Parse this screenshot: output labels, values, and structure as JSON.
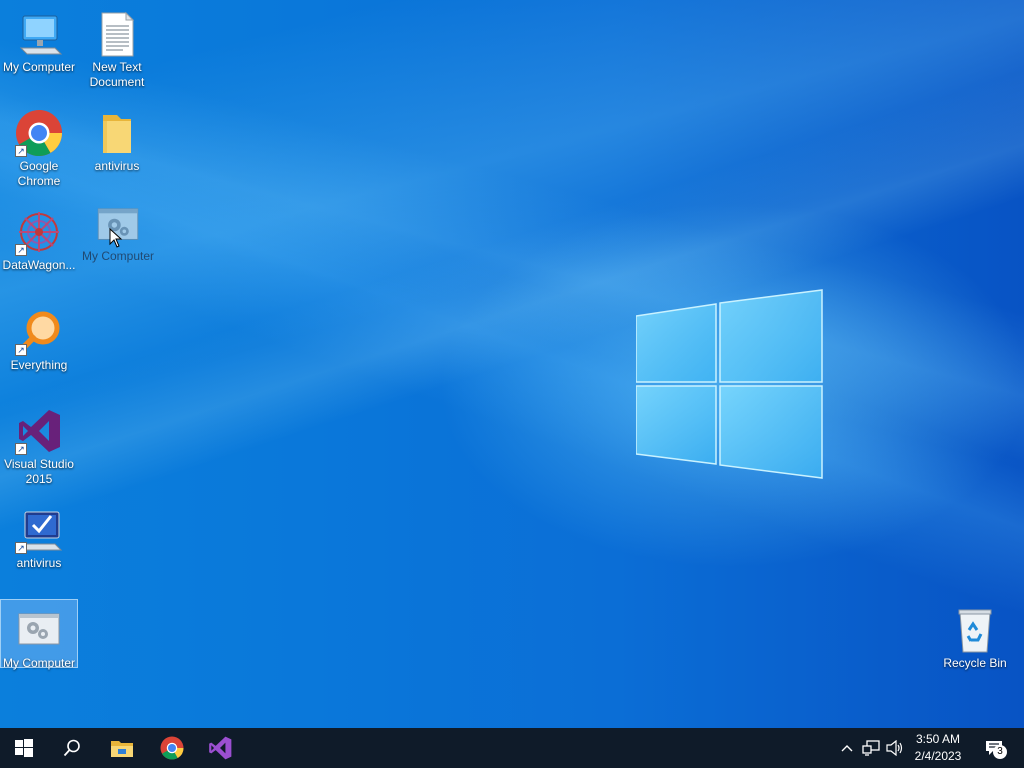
{
  "desktop": {
    "icons": [
      {
        "label": "My Computer",
        "icon": "computer-icon"
      },
      {
        "label": "New Text Document",
        "icon": "text-document-icon"
      },
      {
        "label": "Google Chrome",
        "icon": "chrome-icon"
      },
      {
        "label": "antivirus",
        "icon": "folder-icon"
      },
      {
        "label": "DataWagon...",
        "icon": "datawagon-icon"
      },
      {
        "label": "My Computer",
        "icon": "settings-window-icon"
      },
      {
        "label": "Everything",
        "icon": "everything-search-icon"
      },
      {
        "label": "Visual Studio 2015",
        "icon": "visual-studio-icon"
      },
      {
        "label": "antivirus",
        "icon": "antivirus-monitor-icon"
      },
      {
        "label": "My Computer",
        "icon": "settings-window-icon"
      },
      {
        "label": "Recycle Bin",
        "icon": "recycle-bin-icon"
      }
    ]
  },
  "taskbar": {
    "pinned": [
      "start-icon",
      "search-icon",
      "file-explorer-icon",
      "chrome-icon",
      "visual-studio-icon"
    ],
    "tray": {
      "time": "3:50 AM",
      "date": "2/4/2023",
      "notification_count": "3"
    }
  },
  "colors": {
    "taskbar_bg": "#0f1b29",
    "desktop_accent": "#0a78da",
    "vs_purple": "#6a2fa0"
  }
}
